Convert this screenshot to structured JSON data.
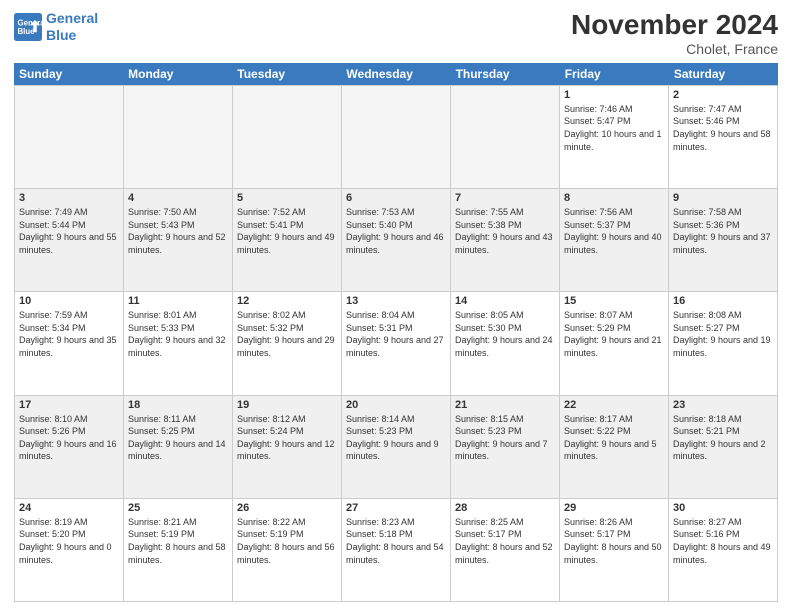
{
  "logo": {
    "line1": "General",
    "line2": "Blue"
  },
  "title": "November 2024",
  "subtitle": "Cholet, France",
  "header_days": [
    "Sunday",
    "Monday",
    "Tuesday",
    "Wednesday",
    "Thursday",
    "Friday",
    "Saturday"
  ],
  "weeks": [
    [
      {
        "day": "",
        "empty": true,
        "text": ""
      },
      {
        "day": "",
        "empty": true,
        "text": ""
      },
      {
        "day": "",
        "empty": true,
        "text": ""
      },
      {
        "day": "",
        "empty": true,
        "text": ""
      },
      {
        "day": "",
        "empty": true,
        "text": ""
      },
      {
        "day": "1",
        "text": "Sunrise: 7:46 AM\nSunset: 5:47 PM\nDaylight: 10 hours and 1 minute."
      },
      {
        "day": "2",
        "text": "Sunrise: 7:47 AM\nSunset: 5:46 PM\nDaylight: 9 hours and 58 minutes."
      }
    ],
    [
      {
        "day": "3",
        "text": "Sunrise: 7:49 AM\nSunset: 5:44 PM\nDaylight: 9 hours and 55 minutes."
      },
      {
        "day": "4",
        "text": "Sunrise: 7:50 AM\nSunset: 5:43 PM\nDaylight: 9 hours and 52 minutes."
      },
      {
        "day": "5",
        "text": "Sunrise: 7:52 AM\nSunset: 5:41 PM\nDaylight: 9 hours and 49 minutes."
      },
      {
        "day": "6",
        "text": "Sunrise: 7:53 AM\nSunset: 5:40 PM\nDaylight: 9 hours and 46 minutes."
      },
      {
        "day": "7",
        "text": "Sunrise: 7:55 AM\nSunset: 5:38 PM\nDaylight: 9 hours and 43 minutes."
      },
      {
        "day": "8",
        "text": "Sunrise: 7:56 AM\nSunset: 5:37 PM\nDaylight: 9 hours and 40 minutes."
      },
      {
        "day": "9",
        "text": "Sunrise: 7:58 AM\nSunset: 5:36 PM\nDaylight: 9 hours and 37 minutes."
      }
    ],
    [
      {
        "day": "10",
        "text": "Sunrise: 7:59 AM\nSunset: 5:34 PM\nDaylight: 9 hours and 35 minutes."
      },
      {
        "day": "11",
        "text": "Sunrise: 8:01 AM\nSunset: 5:33 PM\nDaylight: 9 hours and 32 minutes."
      },
      {
        "day": "12",
        "text": "Sunrise: 8:02 AM\nSunset: 5:32 PM\nDaylight: 9 hours and 29 minutes."
      },
      {
        "day": "13",
        "text": "Sunrise: 8:04 AM\nSunset: 5:31 PM\nDaylight: 9 hours and 27 minutes."
      },
      {
        "day": "14",
        "text": "Sunrise: 8:05 AM\nSunset: 5:30 PM\nDaylight: 9 hours and 24 minutes."
      },
      {
        "day": "15",
        "text": "Sunrise: 8:07 AM\nSunset: 5:29 PM\nDaylight: 9 hours and 21 minutes."
      },
      {
        "day": "16",
        "text": "Sunrise: 8:08 AM\nSunset: 5:27 PM\nDaylight: 9 hours and 19 minutes."
      }
    ],
    [
      {
        "day": "17",
        "text": "Sunrise: 8:10 AM\nSunset: 5:26 PM\nDaylight: 9 hours and 16 minutes."
      },
      {
        "day": "18",
        "text": "Sunrise: 8:11 AM\nSunset: 5:25 PM\nDaylight: 9 hours and 14 minutes."
      },
      {
        "day": "19",
        "text": "Sunrise: 8:12 AM\nSunset: 5:24 PM\nDaylight: 9 hours and 12 minutes."
      },
      {
        "day": "20",
        "text": "Sunrise: 8:14 AM\nSunset: 5:23 PM\nDaylight: 9 hours and 9 minutes."
      },
      {
        "day": "21",
        "text": "Sunrise: 8:15 AM\nSunset: 5:23 PM\nDaylight: 9 hours and 7 minutes."
      },
      {
        "day": "22",
        "text": "Sunrise: 8:17 AM\nSunset: 5:22 PM\nDaylight: 9 hours and 5 minutes."
      },
      {
        "day": "23",
        "text": "Sunrise: 8:18 AM\nSunset: 5:21 PM\nDaylight: 9 hours and 2 minutes."
      }
    ],
    [
      {
        "day": "24",
        "text": "Sunrise: 8:19 AM\nSunset: 5:20 PM\nDaylight: 9 hours and 0 minutes."
      },
      {
        "day": "25",
        "text": "Sunrise: 8:21 AM\nSunset: 5:19 PM\nDaylight: 8 hours and 58 minutes."
      },
      {
        "day": "26",
        "text": "Sunrise: 8:22 AM\nSunset: 5:19 PM\nDaylight: 8 hours and 56 minutes."
      },
      {
        "day": "27",
        "text": "Sunrise: 8:23 AM\nSunset: 5:18 PM\nDaylight: 8 hours and 54 minutes."
      },
      {
        "day": "28",
        "text": "Sunrise: 8:25 AM\nSunset: 5:17 PM\nDaylight: 8 hours and 52 minutes."
      },
      {
        "day": "29",
        "text": "Sunrise: 8:26 AM\nSunset: 5:17 PM\nDaylight: 8 hours and 50 minutes."
      },
      {
        "day": "30",
        "text": "Sunrise: 8:27 AM\nSunset: 5:16 PM\nDaylight: 8 hours and 49 minutes."
      }
    ]
  ]
}
